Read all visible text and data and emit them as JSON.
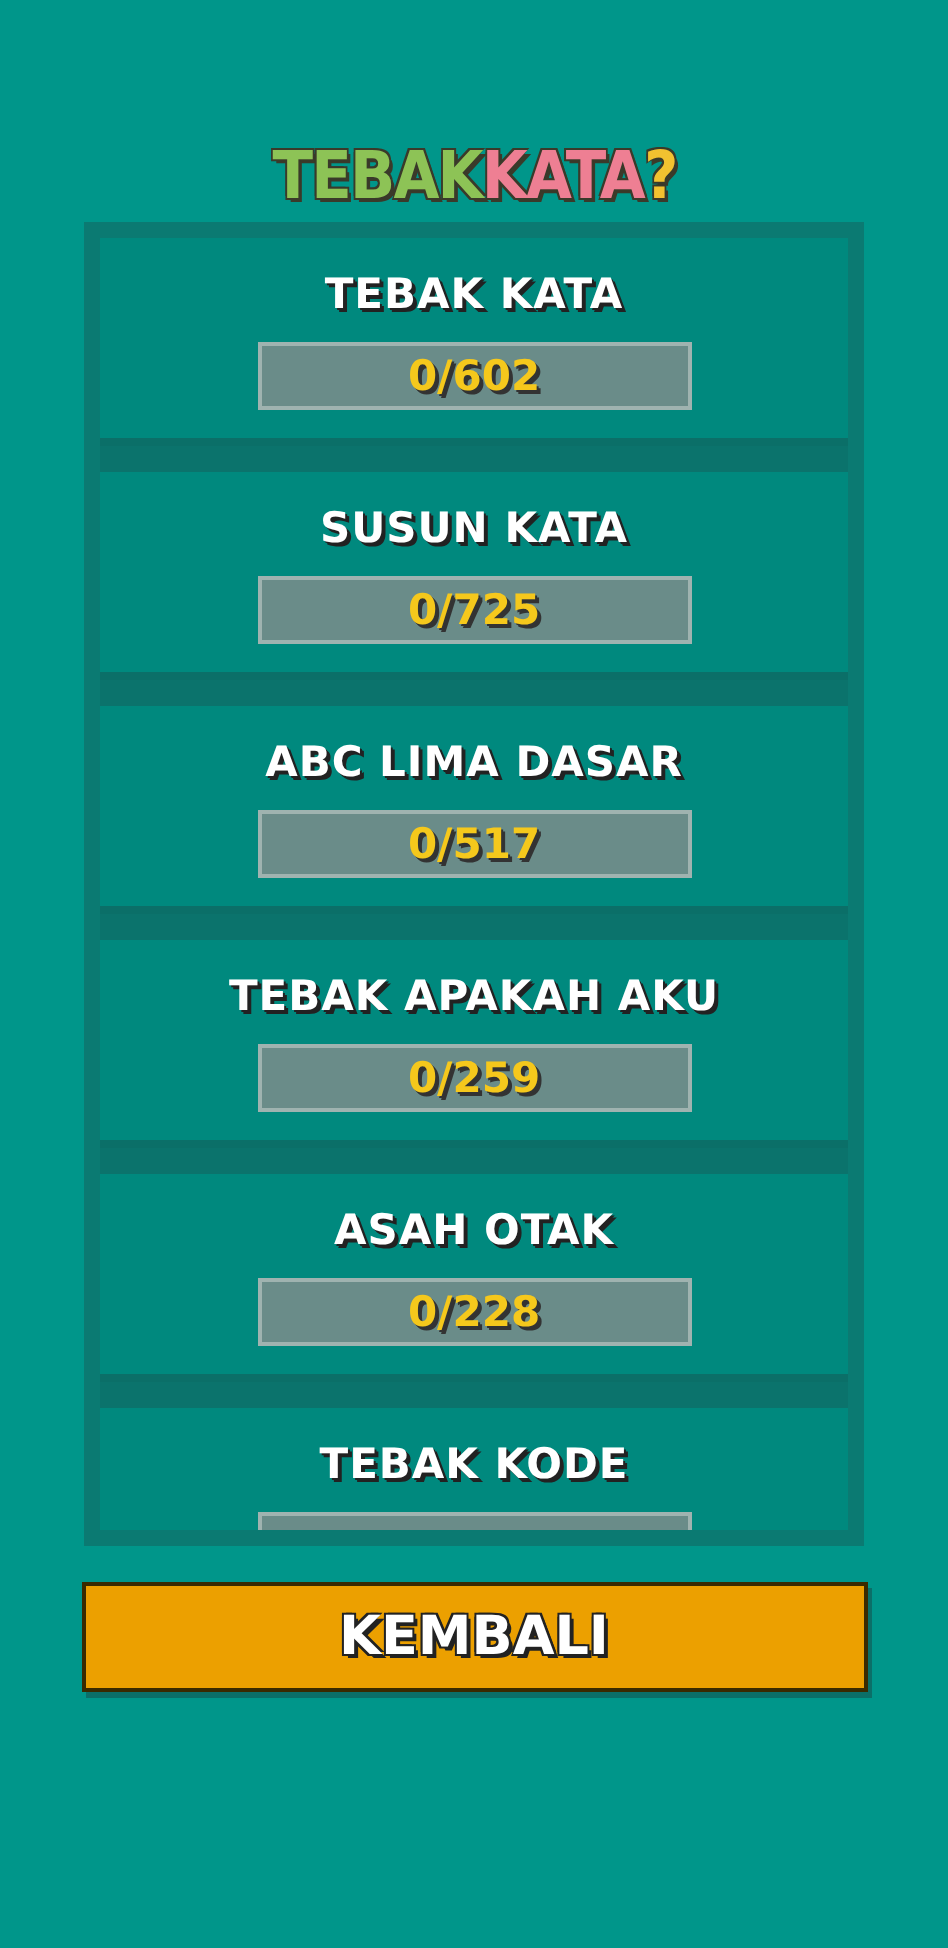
{
  "title": [
    {
      "text": "TEBAK",
      "color": "#8dc356"
    },
    {
      "text": "KATA",
      "color": "#ee7f93"
    },
    {
      "text": "?",
      "color": "#f2c230"
    }
  ],
  "modes": [
    {
      "name": "TEBAK KATA",
      "progress": "0/602"
    },
    {
      "name": "SUSUN KATA",
      "progress": "0/725"
    },
    {
      "name": "ABC LIMA DASAR",
      "progress": "0/517"
    },
    {
      "name": "TEBAK APAKAH AKU",
      "progress": "0/259"
    },
    {
      "name": "ASAH OTAK",
      "progress": "0/228"
    },
    {
      "name": "TEBAK KODE"
    }
  ],
  "back_button": "KEMBALI"
}
